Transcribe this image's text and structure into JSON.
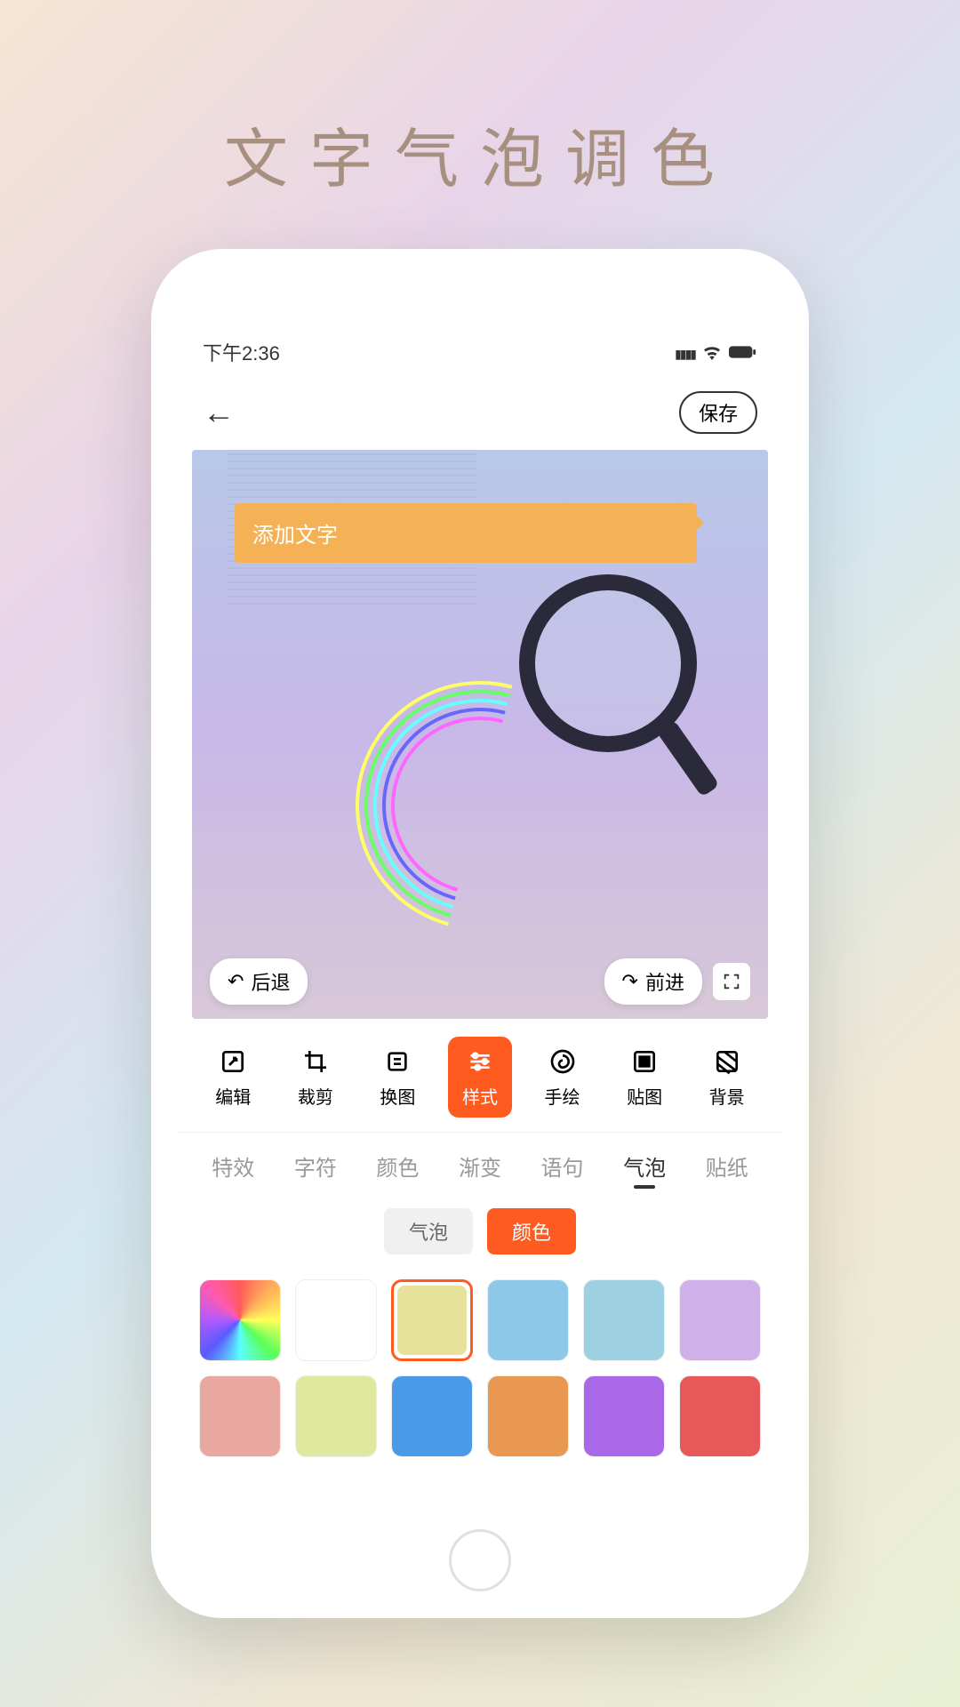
{
  "page_title": "文字气泡调色",
  "status_bar": {
    "time": "下午2:36"
  },
  "header": {
    "save_label": "保存"
  },
  "canvas": {
    "bubble_text": "添加文字",
    "undo_label": "后退",
    "redo_label": "前进"
  },
  "tools": [
    {
      "id": "edit",
      "label": "编辑"
    },
    {
      "id": "crop",
      "label": "裁剪"
    },
    {
      "id": "swap",
      "label": "换图"
    },
    {
      "id": "style",
      "label": "样式",
      "active": true
    },
    {
      "id": "draw",
      "label": "手绘"
    },
    {
      "id": "sticker",
      "label": "贴图"
    },
    {
      "id": "bg",
      "label": "背景"
    }
  ],
  "tabs": [
    {
      "id": "effect",
      "label": "特效"
    },
    {
      "id": "char",
      "label": "字符"
    },
    {
      "id": "color",
      "label": "颜色"
    },
    {
      "id": "gradient",
      "label": "渐变"
    },
    {
      "id": "phrase",
      "label": "语句"
    },
    {
      "id": "bubble",
      "label": "气泡",
      "active": true
    },
    {
      "id": "sticker",
      "label": "贴纸"
    }
  ],
  "subtabs": [
    {
      "id": "bubble",
      "label": "气泡"
    },
    {
      "id": "color",
      "label": "颜色",
      "active": true
    }
  ],
  "swatches": [
    {
      "type": "rainbow"
    },
    {
      "color": "#ffffff"
    },
    {
      "color": "#e6e29a",
      "selected": true
    },
    {
      "color": "#8dc8e8"
    },
    {
      "color": "#9dd0e0"
    },
    {
      "color": "#d0b0e8"
    },
    {
      "color": "#e8a8a0"
    },
    {
      "color": "#e0e8a0"
    },
    {
      "color": "#4a9ae8"
    },
    {
      "color": "#e89850"
    },
    {
      "color": "#a868e8"
    },
    {
      "color": "#e85858"
    }
  ],
  "colors": {
    "accent": "#ff5a1f"
  }
}
